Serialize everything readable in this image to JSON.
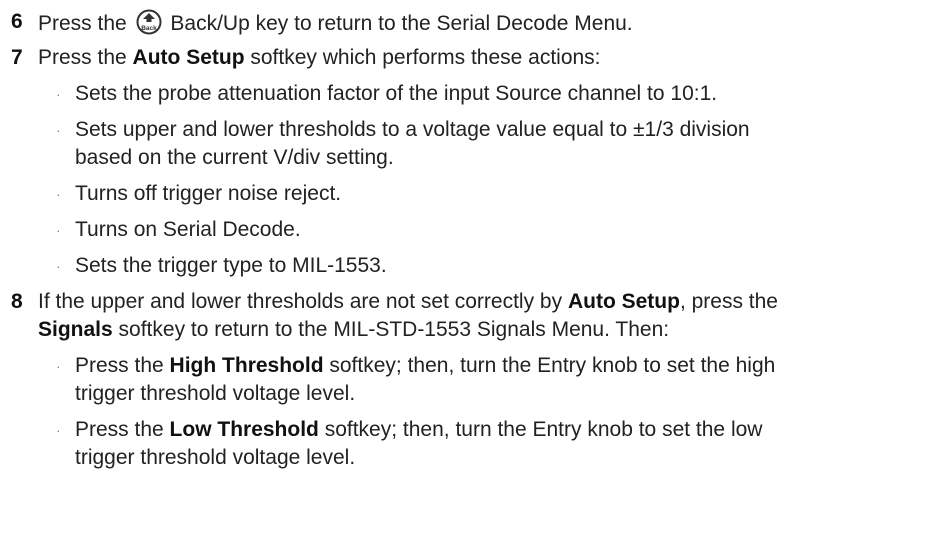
{
  "steps": [
    {
      "number": "6",
      "text_before_icon": "Press the",
      "icon": "back-up-key-icon",
      "icon_label": "Back",
      "text_after_icon": "Back/Up key to return to the Serial Decode Menu."
    },
    {
      "number": "7",
      "segments": [
        "Press the ",
        "Auto Setup",
        " softkey which performs these actions:"
      ],
      "bullets": [
        {
          "lines": [
            "Sets the probe attenuation factor of the input Source channel to 10:1."
          ]
        },
        {
          "lines": [
            "Sets upper and lower thresholds to a voltage value equal to ±1/3 division",
            "based on the current V/div setting."
          ]
        },
        {
          "lines": [
            "Turns off trigger noise reject."
          ]
        },
        {
          "lines": [
            "Turns on Serial Decode."
          ]
        },
        {
          "lines": [
            "Sets the trigger type to MIL-1553."
          ]
        }
      ]
    },
    {
      "number": "8",
      "line1": [
        "If the upper and lower thresholds are not set correctly by ",
        "Auto Setup",
        ", press the"
      ],
      "line2": [
        "Signals",
        " softkey to return to the MIL-STD-1553 Signals Menu. Then:"
      ],
      "bullets": [
        {
          "line1": [
            "Press the ",
            "High Threshold",
            " softkey; then, turn the Entry knob to set the high"
          ],
          "line2": "trigger threshold voltage level."
        },
        {
          "line1": [
            "Press the ",
            "Low Threshold",
            " softkey; then, turn the Entry knob to set the low"
          ],
          "line2": "trigger threshold voltage level."
        }
      ]
    }
  ],
  "bullet_glyph": "·",
  "colors": {
    "text": "#222222",
    "bullet": "#8a8a8a",
    "icon": "#333333"
  }
}
